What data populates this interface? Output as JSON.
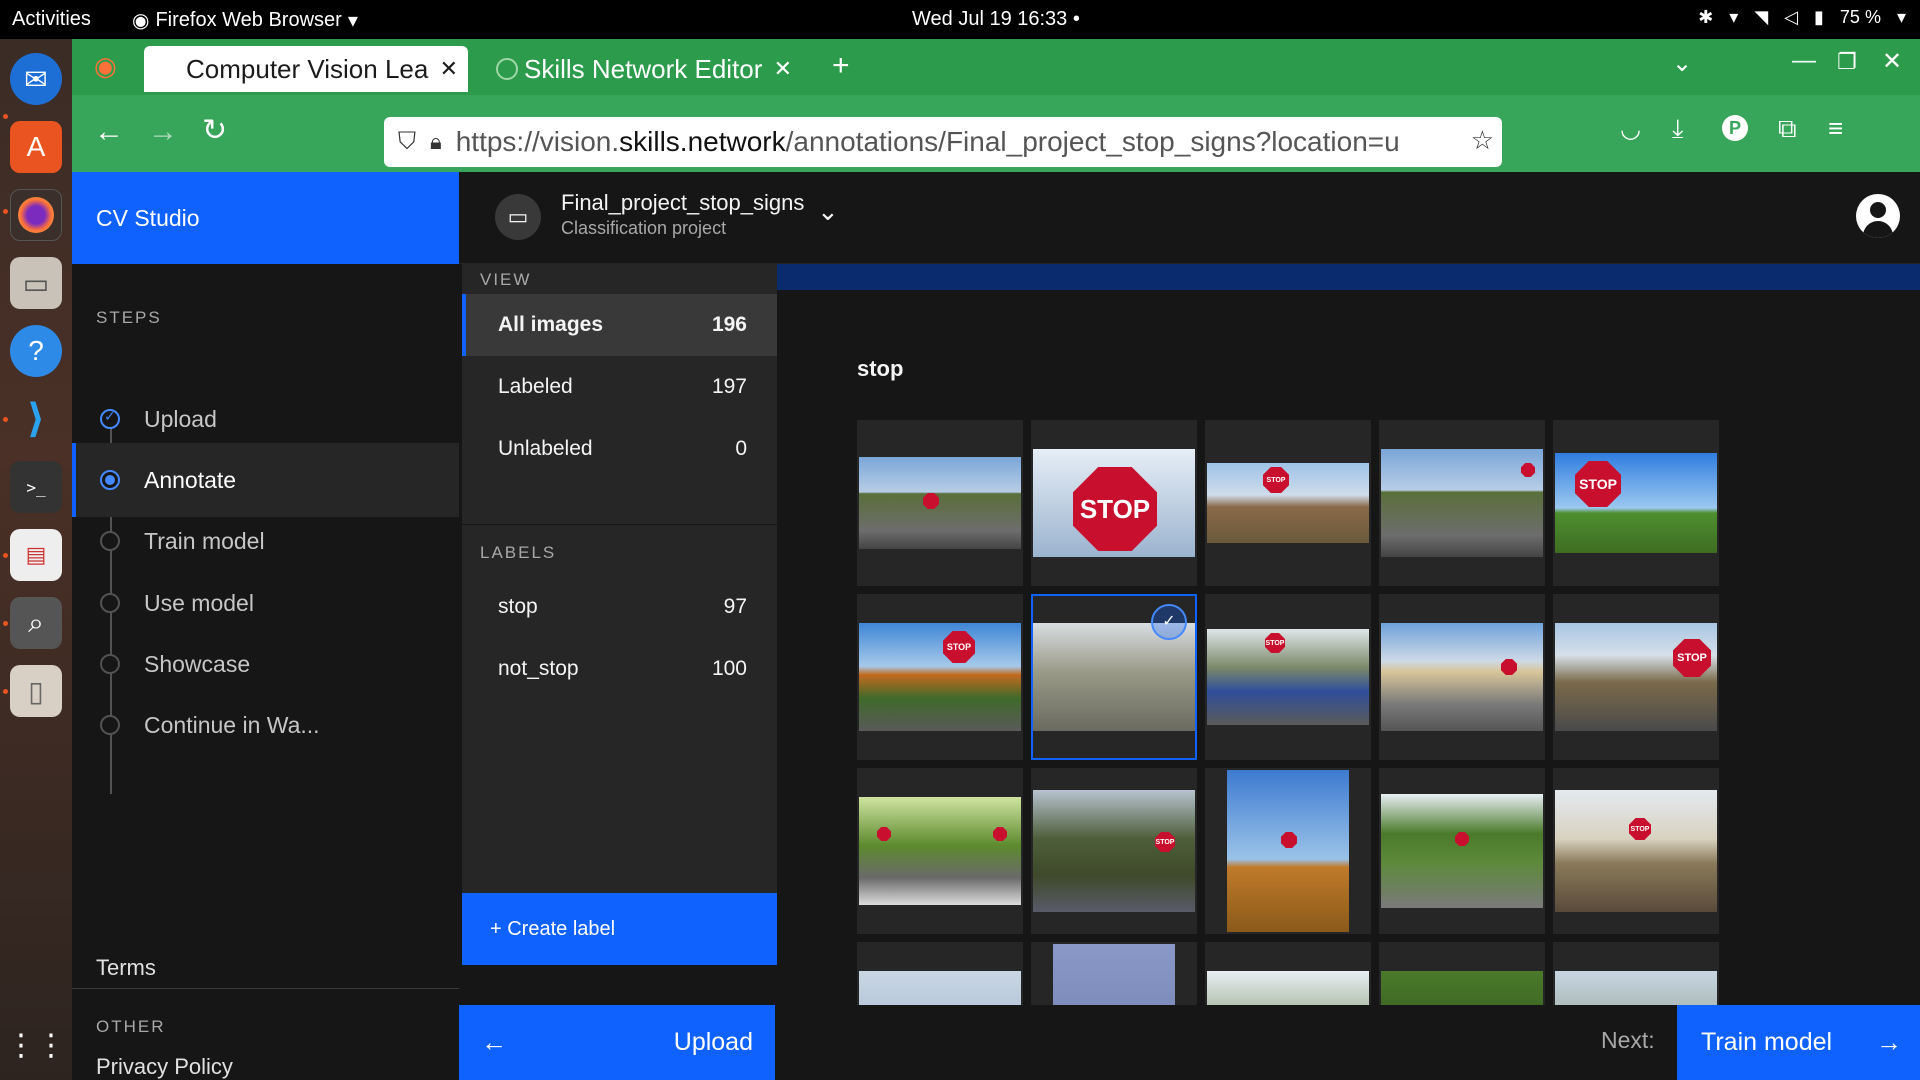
{
  "system": {
    "activities": "Activities",
    "app_menu": "Firefox Web Browser",
    "clock": "Wed Jul 19  16:33",
    "battery": "75 %"
  },
  "browser": {
    "tabs": [
      {
        "label": "Computer Vision Lea",
        "active": true
      },
      {
        "label": "Skills Network Editor",
        "active": false
      }
    ],
    "url_prefix": "https://vision.",
    "url_domain": "skills.network",
    "url_path": "/annotations/Final_project_stop_signs?location=u"
  },
  "app": {
    "brand": "CV Studio",
    "project_name": "Final_project_stop_signs",
    "project_type": "Classification project",
    "steps_title": "STEPS",
    "steps": [
      {
        "label": "Upload",
        "state": "done"
      },
      {
        "label": "Annotate",
        "state": "current"
      },
      {
        "label": "Train model",
        "state": "todo"
      },
      {
        "label": "Use model",
        "state": "todo"
      },
      {
        "label": "Showcase",
        "state": "todo"
      },
      {
        "label": "Continue in Wa...",
        "state": "todo"
      }
    ],
    "other_title": "OTHER",
    "other_links": [
      "Privacy Policy",
      "Terms"
    ],
    "view_title": "VIEW",
    "views": [
      {
        "label": "All images",
        "count": "196",
        "active": true
      },
      {
        "label": "Labeled",
        "count": "197",
        "active": false
      },
      {
        "label": "Unlabeled",
        "count": "0",
        "active": false
      }
    ],
    "labels_title": "LABELS",
    "labels": [
      {
        "label": "stop",
        "count": "97"
      },
      {
        "label": "not_stop",
        "count": "100"
      }
    ],
    "create_label": "+ Create label",
    "gallery_heading": "stop",
    "footer": {
      "back_label": "Upload",
      "next_prefix": "Next:",
      "next_label": "Train model"
    }
  },
  "colors": {
    "accent": "#0f62fe",
    "firefox_green": "#2c9c4c",
    "stop_red": "#c8102e"
  }
}
